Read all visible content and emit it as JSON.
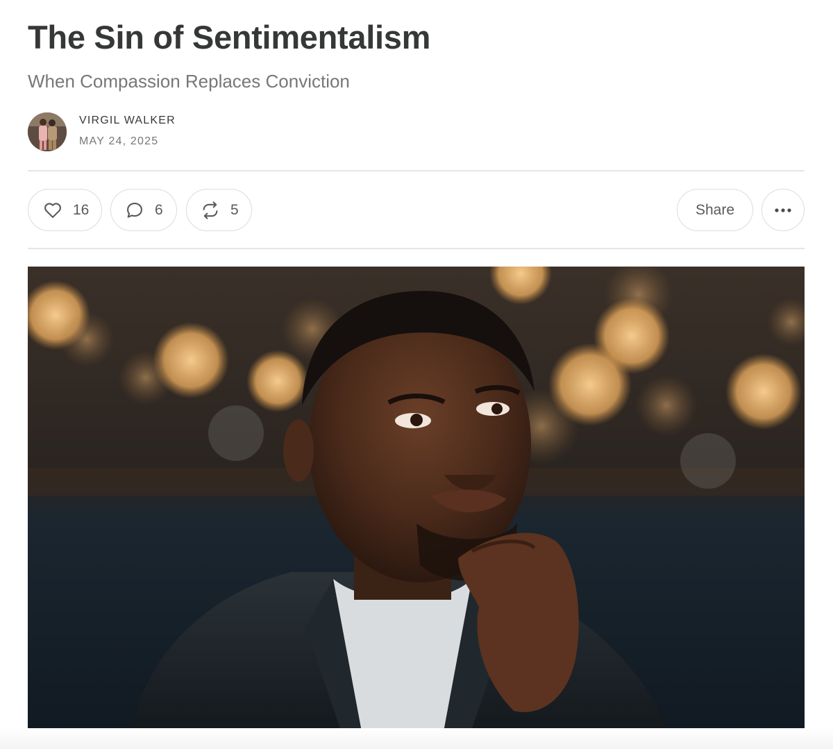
{
  "post": {
    "title": "The Sin of Sentimentalism",
    "subtitle": "When Compassion Replaces Conviction",
    "author": "VIRGIL WALKER",
    "date": "MAY 24, 2025"
  },
  "actions": {
    "likes": "16",
    "comments": "6",
    "restacks": "5",
    "share_label": "Share"
  },
  "icons": {
    "like": "heart-icon",
    "comment": "speech-bubble-icon",
    "restack": "restack-arrows-icon",
    "more": "ellipsis-icon"
  },
  "colors": {
    "title": "#363737",
    "muted": "#777777",
    "border": "#dcdcdc",
    "divider": "#e6e6e6"
  }
}
